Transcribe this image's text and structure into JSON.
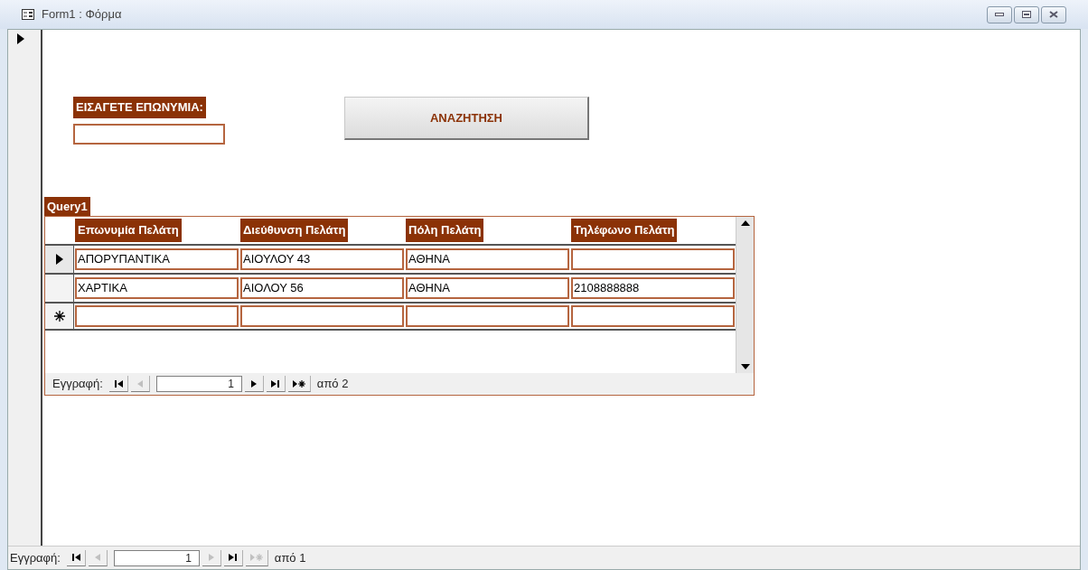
{
  "window": {
    "title": "Form1 : Φόρμα"
  },
  "form": {
    "search_label": "ΕΙΣΑΓΕΤΕ ΕΠΩΝΥΜΙΑ:",
    "search_button": "ΑΝΑΖΗΤΗΣΗ",
    "subform": {
      "title": "Query1",
      "columns": [
        "Επωνυμία Πελάτη",
        "Διεύθυνση Πελάτη",
        "Πόλη Πελάτη",
        "Τηλέφωνο Πελάτη"
      ],
      "rows": [
        {
          "selected": true,
          "cells": [
            "ΑΠΟΡΥΠΑΝΤΙΚΑ",
            "ΑΙΟΥΛΟΥ 43",
            "ΑΘΗΝΑ",
            null
          ]
        },
        {
          "selected": false,
          "cells": [
            "ΧΑΡΤΙΚΑ",
            "ΑΙΟΛΟΥ 56",
            "ΑΘΗΝΑ",
            "2108888888"
          ]
        }
      ],
      "navigator": {
        "label": "Εγγραφή:",
        "record": "1",
        "total": "από 2",
        "buttons": [
          {
            "kind": "first",
            "disabled": false
          },
          {
            "kind": "prev",
            "disabled": true
          },
          {
            "kind": "next",
            "disabled": false
          },
          {
            "kind": "last",
            "disabled": false
          },
          {
            "kind": "new",
            "disabled": false
          }
        ]
      }
    }
  },
  "navigator": {
    "label": "Εγγραφή:",
    "record": "1",
    "total": "από 1",
    "buttons": [
      {
        "kind": "first",
        "disabled": false
      },
      {
        "kind": "prev",
        "disabled": true
      },
      {
        "kind": "next",
        "disabled": true
      },
      {
        "kind": "last",
        "disabled": false
      },
      {
        "kind": "new",
        "disabled": true
      }
    ]
  }
}
